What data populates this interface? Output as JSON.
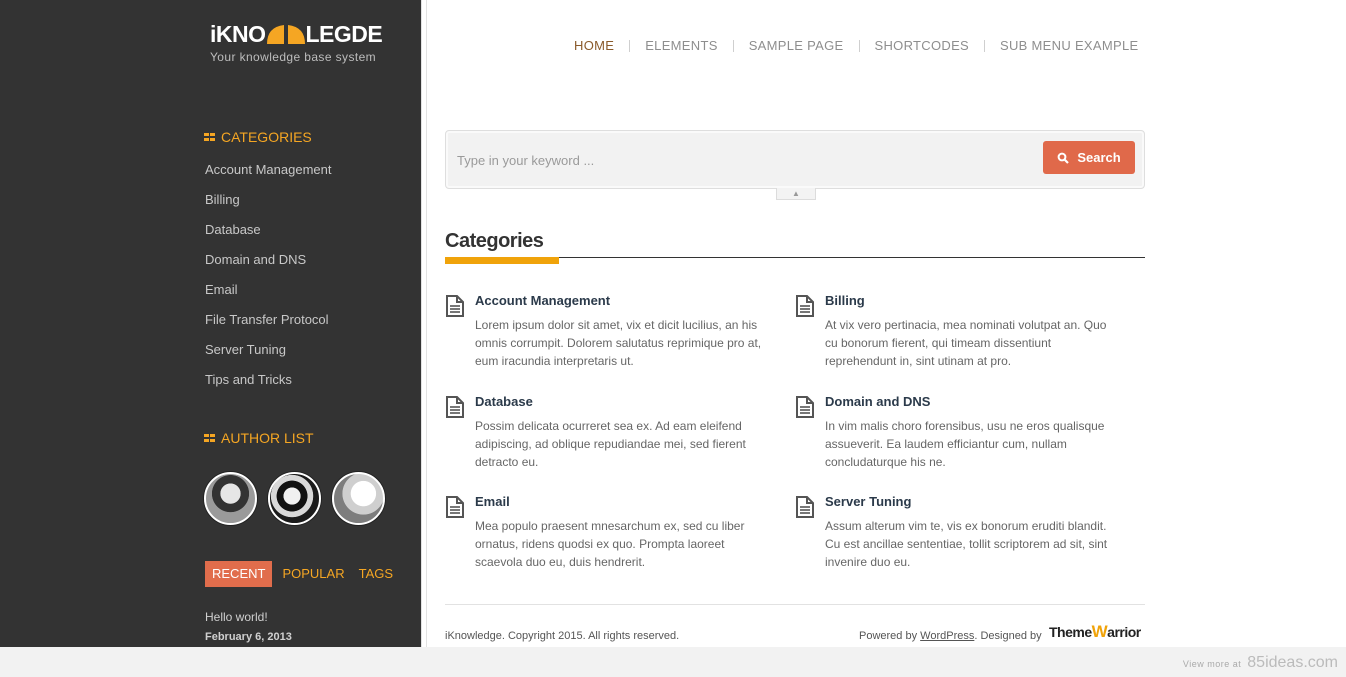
{
  "brand": {
    "logo_left": "iKNO",
    "logo_right": "LEGDE",
    "tagline": "Your knowledge base system",
    "accent_color": "#f5a623",
    "button_color": "#e0694a"
  },
  "sidebar": {
    "categories_title": "CATEGORIES",
    "categories": [
      "Account Management",
      "Billing",
      "Database",
      "Domain and DNS",
      "Email",
      "File Transfer Protocol",
      "Server Tuning",
      "Tips and Tricks"
    ],
    "authors_title": "AUTHOR LIST",
    "tabs": [
      "RECENT",
      "POPULAR",
      "TAGS"
    ],
    "recent_post_title": "Hello world!",
    "recent_post_date": "February 6, 2013"
  },
  "nav": {
    "items": [
      "HOME",
      "ELEMENTS",
      "SAMPLE PAGE",
      "SHORTCODES",
      "SUB MENU EXAMPLE"
    ]
  },
  "search": {
    "placeholder": "Type in your keyword ...",
    "button_label": "Search",
    "toggle_glyph": "▲"
  },
  "main": {
    "section_title": "Categories",
    "categories": [
      {
        "name": "Account Management",
        "desc": "Lorem ipsum dolor sit amet, vix et dicit lucilius, an his omnis corrumpit. Dolorem salutatus reprimique pro at, eum iracundia interpretaris ut."
      },
      {
        "name": "Billing",
        "desc": "At vix vero pertinacia, mea nominati volutpat an. Quo cu bonorum fierent, qui timeam dissentiunt reprehendunt in, sint utinam at pro."
      },
      {
        "name": "Database",
        "desc": "Possim delicata ocurreret sea ex. Ad eam eleifend adipiscing, ad oblique repudiandae mei, sed fierent detracto eu."
      },
      {
        "name": "Domain and DNS",
        "desc": "In vim malis choro forensibus, usu ne eros qualisque assueverit. Ea laudem efficiantur cum, nullam concludaturque his ne."
      },
      {
        "name": "Email",
        "desc": "Mea populo praesent mnesarchum ex, sed cu liber ornatus, ridens quodsi ex quo. Prompta laoreet scaevola duo eu, duis hendrerit."
      },
      {
        "name": "Server Tuning",
        "desc": "Assum alterum vim te, vis ex bonorum eruditi blandit. Cu est ancillae sententiae, tollit scriptorem ad sit, sint invenire duo eu."
      }
    ]
  },
  "footer": {
    "copyright": "iKnowledge. Copyright 2015. All rights reserved.",
    "powered_prefix": "Powered by ",
    "powered_link": "WordPress",
    "designed_by": ". Designed by",
    "designer_logo_left": "Theme",
    "designer_logo_mark": "W",
    "designer_logo_right": "arrior"
  },
  "watermark": {
    "prefix": "View more at",
    "site": "85ideas.com"
  }
}
